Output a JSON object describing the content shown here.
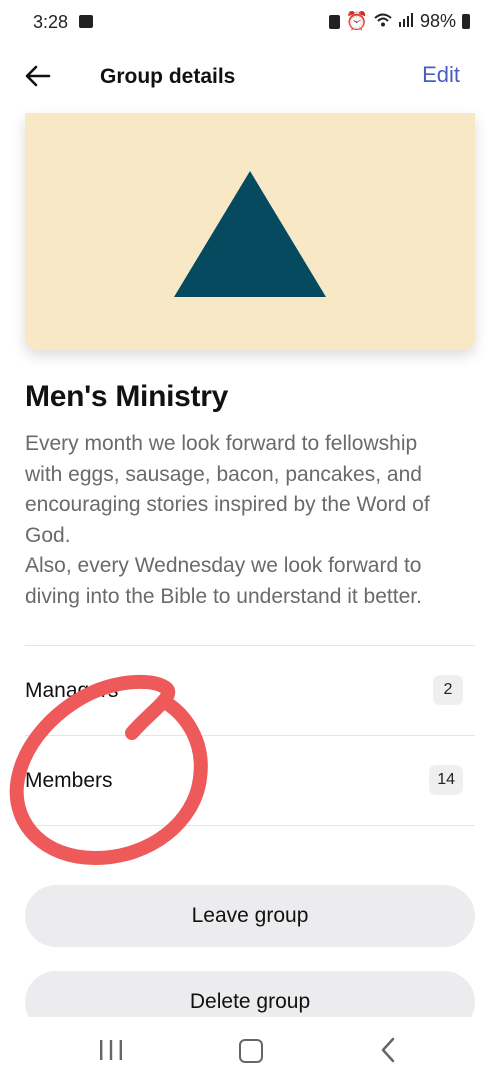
{
  "status_bar": {
    "time": "3:28",
    "battery": "98%"
  },
  "app_bar": {
    "title": "Group details",
    "edit_label": "Edit"
  },
  "group": {
    "name": "Men's Ministry",
    "description_lines": [
      "Every month we look forward to fellowship",
      "with eggs, sausage, bacon, pancakes, and",
      "encouraging stories inspired by the Word of",
      "God.",
      "Also, every Wednesday we look forward to",
      "diving into the Bible to understand it better."
    ],
    "cover_bg": "#f8e8c6",
    "cover_shape_color": "#054a5e"
  },
  "rows": [
    {
      "label": "Managers",
      "count": "2"
    },
    {
      "label": "Members",
      "count": "14"
    }
  ],
  "actions": {
    "leave": "Leave group",
    "delete": "Delete group"
  },
  "colors": {
    "accent": "#4a5ec2",
    "annotation": "#ee5a5a"
  },
  "icons": [
    "back-arrow-icon",
    "gallery-icon",
    "recent-apps-icon",
    "home-icon",
    "nav-back-icon"
  ]
}
